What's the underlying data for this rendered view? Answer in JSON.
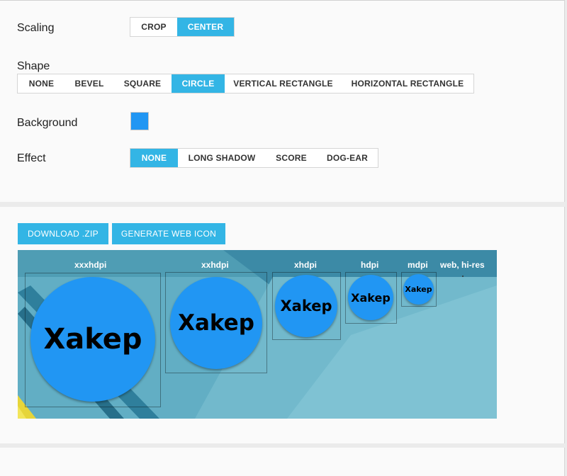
{
  "scaling": {
    "label": "Scaling",
    "options": [
      "CROP",
      "CENTER"
    ],
    "selected": "CENTER"
  },
  "shape": {
    "label": "Shape",
    "options": [
      "NONE",
      "BEVEL",
      "SQUARE",
      "CIRCLE",
      "VERTICAL RECTANGLE",
      "HORIZONTAL RECTANGLE"
    ],
    "selected": "CIRCLE"
  },
  "background": {
    "label": "Background",
    "color": "#2196f3"
  },
  "effect": {
    "label": "Effect",
    "options": [
      "NONE",
      "LONG SHADOW",
      "SCORE",
      "DOG-EAR"
    ],
    "selected": "NONE"
  },
  "actions": {
    "download_label": "DOWNLOAD .ZIP",
    "web_icon_label": "GENERATE WEB ICON"
  },
  "preview": {
    "icon_text": "Xakep",
    "densities": [
      "xxxhdpi",
      "xxhdpi",
      "xhdpi",
      "hdpi",
      "mdpi",
      "web, hi-res"
    ]
  },
  "colors": {
    "accent": "#33b5e5",
    "icon_fill": "#2196f3"
  }
}
